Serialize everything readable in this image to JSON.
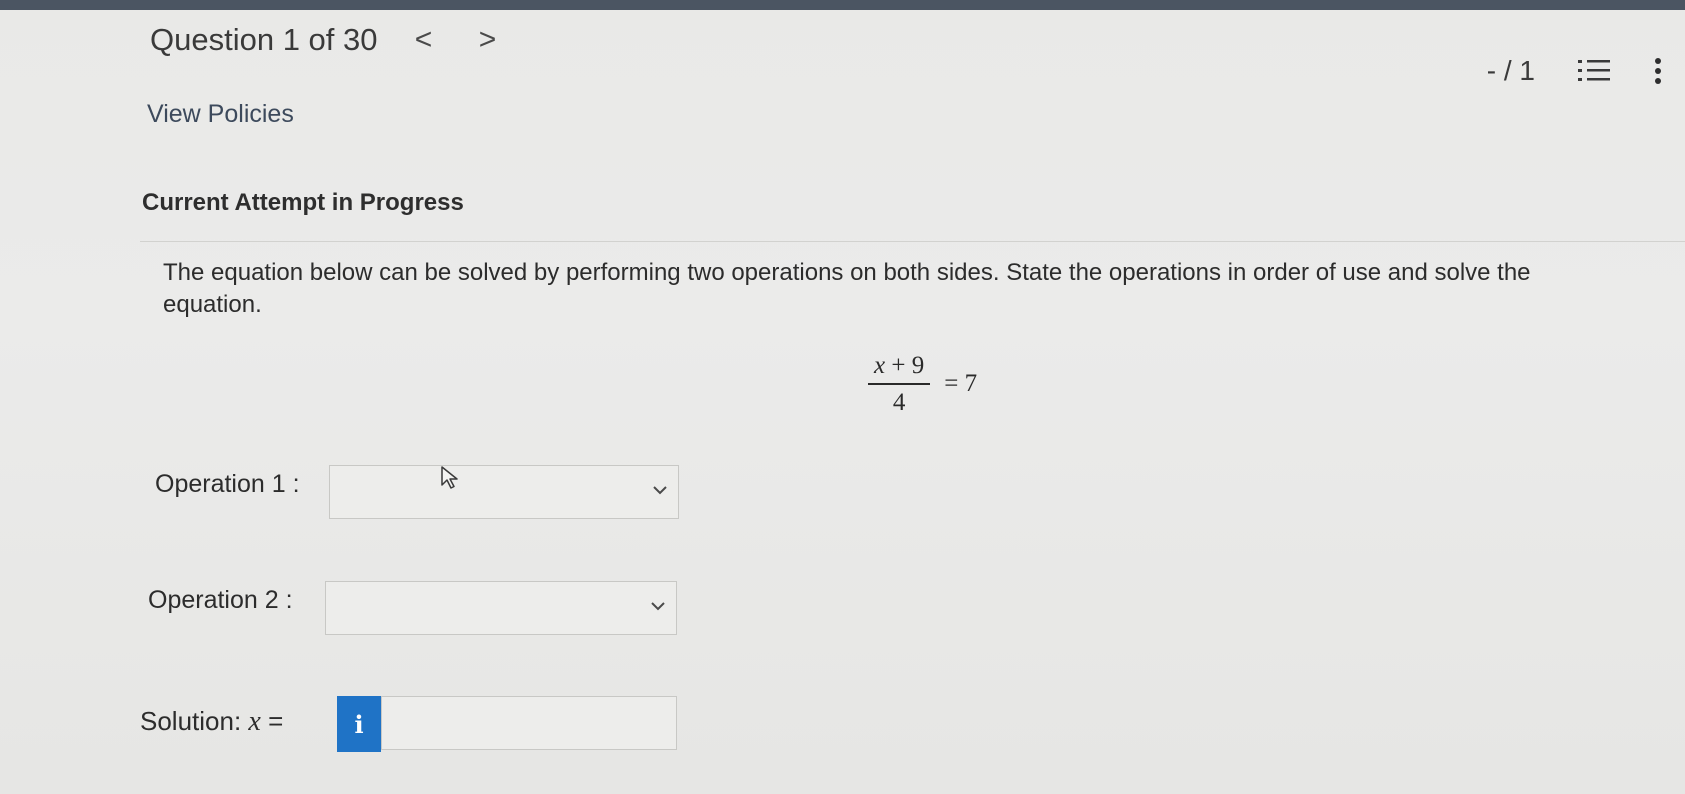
{
  "header": {
    "question_title": "Question 1 of 30",
    "prev_icon": "chevron-left-icon",
    "prev_glyph": "<",
    "next_icon": "chevron-right-icon",
    "next_glyph": ">",
    "view_policies": "View Policies",
    "score": "- / 1",
    "list_icon": "numbered-list-icon",
    "menu_icon": "vertical-dots-icon"
  },
  "attempt": {
    "heading": "Current Attempt in Progress"
  },
  "question": {
    "prompt": "The equation below can be solved by performing two operations on both sides. State the operations in order of use and solve the equation.",
    "equation": {
      "numerator_var": "x",
      "numerator_rest": " + 9",
      "denominator": "4",
      "rhs": "= 7"
    }
  },
  "operations": [
    {
      "label": "Operation 1 :",
      "selected": "",
      "icon": "chevron-down-icon"
    },
    {
      "label": "Operation 2 :",
      "selected": "",
      "icon": "chevron-down-icon"
    }
  ],
  "solution": {
    "label": "Solution:",
    "variable": "x",
    "equals": "=",
    "info_glyph": "i",
    "info_icon": "info-icon",
    "value": ""
  },
  "colors": {
    "top_bar": "#4b5562",
    "info_button": "#1f73c6",
    "background": "#e9e9e7"
  }
}
